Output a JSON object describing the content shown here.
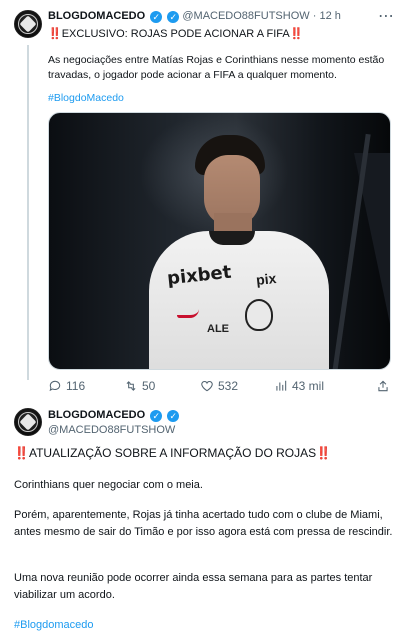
{
  "tweet1": {
    "display_name": "BLOGDOMACEDO",
    "handle": "@MACEDO88FUTSHOW",
    "separator": "·",
    "time": "12 h",
    "more_glyph": "⋯",
    "headline_prefix": "‼️",
    "headline": "EXCLUSIVO: ROJAS PODE ACIONAR A FIFA",
    "headline_suffix": "‼️",
    "body": "As negociações entre Matías Rojas e Corinthians nesse momento estão travadas, o jogador pode acionar a FIFA a qualquer momento.",
    "hashtag": "#BlogdoMacedo",
    "photo": {
      "jersey_sponsor": "pixbet",
      "sleeve_text": "pix",
      "jersey_lettering": "ALE"
    },
    "actions": {
      "replies": "116",
      "retweets": "50",
      "likes": "532",
      "views": "43 mil"
    }
  },
  "tweet2": {
    "display_name": "BLOGDOMACEDO",
    "handle": "@MACEDO88FUTSHOW",
    "title_prefix": "‼️",
    "title": "ATUALIZAÇÃO SOBRE A INFORMAÇÃO DO ROJAS",
    "title_suffix": "‼️",
    "p1": "Corinthians quer negociar com o meia.",
    "p2": "Porém, aparentemente, Rojas já tinha acertado tudo com o clube de Miami, antes mesmo de sair do Timão e por isso agora está com pressa de rescindir.",
    "p3": "Uma nova reunião pode ocorrer ainda essa semana para as partes tentar viabilizar um acordo.",
    "hashtag": "#Blogdomacedo"
  },
  "colors": {
    "accent": "#1d9bf0",
    "muted": "#536471",
    "alert": "#e0245e"
  }
}
